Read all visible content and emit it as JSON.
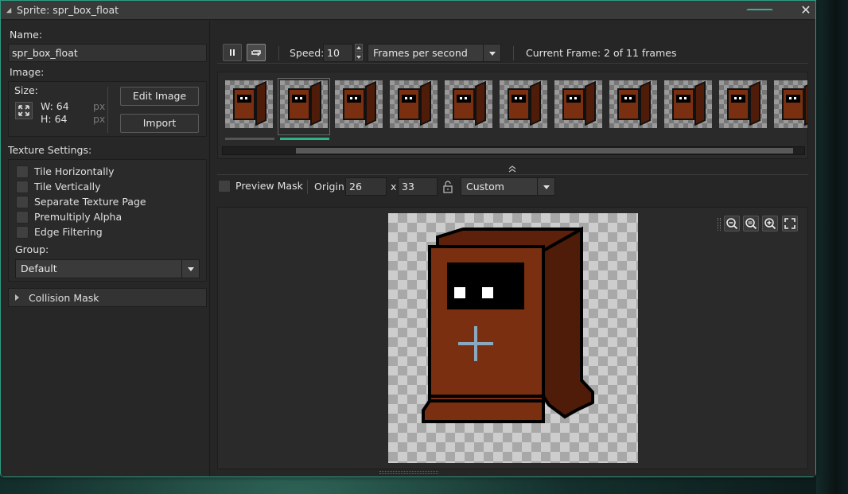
{
  "window": {
    "title": "Sprite: spr_box_float",
    "accent_color": "#2f9c82"
  },
  "left": {
    "name_label": "Name:",
    "name_value": "spr_box_float",
    "image_label": "Image:",
    "size_label": "Size:",
    "width": "W: 64",
    "height": "H: 64",
    "px_unit": "px",
    "edit_image_label": "Edit Image",
    "import_label": "Import",
    "texture_settings_label": "Texture Settings:",
    "checkboxes": [
      {
        "label": "Tile Horizontally",
        "checked": false
      },
      {
        "label": "Tile Vertically",
        "checked": false
      },
      {
        "label": "Separate Texture Page",
        "checked": false
      },
      {
        "label": "Premultiply Alpha",
        "checked": false
      },
      {
        "label": "Edge Filtering",
        "checked": false
      }
    ],
    "group_label": "Group:",
    "group_value": "Default",
    "collision_mask_label": "Collision Mask"
  },
  "toolbar": {
    "speed_label": "Speed:",
    "speed_value": "10",
    "speed_unit": "Frames per second",
    "current_frame": "Current Frame: 2 of 11 frames",
    "selected_frame": 2,
    "visible_frames": 11
  },
  "mask": {
    "preview_mask_label": "Preview Mask",
    "origin_label": "Origin:",
    "origin_x": "26",
    "origin_separator": "x",
    "origin_y": "33",
    "origin_mode": "Custom"
  },
  "colors": {
    "box_front": "#7a3010",
    "box_side": "#4e1c08",
    "selection_accent": "#2fb487"
  },
  "icons": [
    "pause-icon",
    "loop-icon",
    "lock-icon",
    "zoom-out-icon",
    "zoom-reset-icon",
    "zoom-in-icon",
    "fullscreen-icon",
    "expand-size-icon",
    "chevron-up-double-icon"
  ]
}
